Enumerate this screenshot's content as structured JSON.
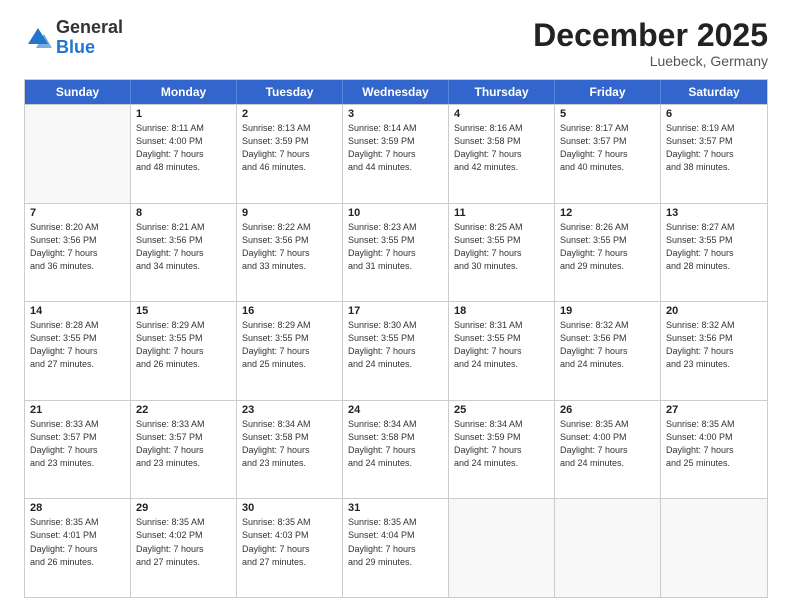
{
  "header": {
    "logo_general": "General",
    "logo_blue": "Blue",
    "month_title": "December 2025",
    "location": "Luebeck, Germany"
  },
  "calendar": {
    "days_of_week": [
      "Sunday",
      "Monday",
      "Tuesday",
      "Wednesday",
      "Thursday",
      "Friday",
      "Saturday"
    ],
    "rows": [
      [
        {
          "day": "",
          "empty": true
        },
        {
          "day": "1",
          "lines": [
            "Sunrise: 8:11 AM",
            "Sunset: 4:00 PM",
            "Daylight: 7 hours",
            "and 48 minutes."
          ]
        },
        {
          "day": "2",
          "lines": [
            "Sunrise: 8:13 AM",
            "Sunset: 3:59 PM",
            "Daylight: 7 hours",
            "and 46 minutes."
          ]
        },
        {
          "day": "3",
          "lines": [
            "Sunrise: 8:14 AM",
            "Sunset: 3:59 PM",
            "Daylight: 7 hours",
            "and 44 minutes."
          ]
        },
        {
          "day": "4",
          "lines": [
            "Sunrise: 8:16 AM",
            "Sunset: 3:58 PM",
            "Daylight: 7 hours",
            "and 42 minutes."
          ]
        },
        {
          "day": "5",
          "lines": [
            "Sunrise: 8:17 AM",
            "Sunset: 3:57 PM",
            "Daylight: 7 hours",
            "and 40 minutes."
          ]
        },
        {
          "day": "6",
          "lines": [
            "Sunrise: 8:19 AM",
            "Sunset: 3:57 PM",
            "Daylight: 7 hours",
            "and 38 minutes."
          ]
        }
      ],
      [
        {
          "day": "7",
          "lines": [
            "Sunrise: 8:20 AM",
            "Sunset: 3:56 PM",
            "Daylight: 7 hours",
            "and 36 minutes."
          ]
        },
        {
          "day": "8",
          "lines": [
            "Sunrise: 8:21 AM",
            "Sunset: 3:56 PM",
            "Daylight: 7 hours",
            "and 34 minutes."
          ]
        },
        {
          "day": "9",
          "lines": [
            "Sunrise: 8:22 AM",
            "Sunset: 3:56 PM",
            "Daylight: 7 hours",
            "and 33 minutes."
          ]
        },
        {
          "day": "10",
          "lines": [
            "Sunrise: 8:23 AM",
            "Sunset: 3:55 PM",
            "Daylight: 7 hours",
            "and 31 minutes."
          ]
        },
        {
          "day": "11",
          "lines": [
            "Sunrise: 8:25 AM",
            "Sunset: 3:55 PM",
            "Daylight: 7 hours",
            "and 30 minutes."
          ]
        },
        {
          "day": "12",
          "lines": [
            "Sunrise: 8:26 AM",
            "Sunset: 3:55 PM",
            "Daylight: 7 hours",
            "and 29 minutes."
          ]
        },
        {
          "day": "13",
          "lines": [
            "Sunrise: 8:27 AM",
            "Sunset: 3:55 PM",
            "Daylight: 7 hours",
            "and 28 minutes."
          ]
        }
      ],
      [
        {
          "day": "14",
          "lines": [
            "Sunrise: 8:28 AM",
            "Sunset: 3:55 PM",
            "Daylight: 7 hours",
            "and 27 minutes."
          ]
        },
        {
          "day": "15",
          "lines": [
            "Sunrise: 8:29 AM",
            "Sunset: 3:55 PM",
            "Daylight: 7 hours",
            "and 26 minutes."
          ]
        },
        {
          "day": "16",
          "lines": [
            "Sunrise: 8:29 AM",
            "Sunset: 3:55 PM",
            "Daylight: 7 hours",
            "and 25 minutes."
          ]
        },
        {
          "day": "17",
          "lines": [
            "Sunrise: 8:30 AM",
            "Sunset: 3:55 PM",
            "Daylight: 7 hours",
            "and 24 minutes."
          ]
        },
        {
          "day": "18",
          "lines": [
            "Sunrise: 8:31 AM",
            "Sunset: 3:55 PM",
            "Daylight: 7 hours",
            "and 24 minutes."
          ]
        },
        {
          "day": "19",
          "lines": [
            "Sunrise: 8:32 AM",
            "Sunset: 3:56 PM",
            "Daylight: 7 hours",
            "and 24 minutes."
          ]
        },
        {
          "day": "20",
          "lines": [
            "Sunrise: 8:32 AM",
            "Sunset: 3:56 PM",
            "Daylight: 7 hours",
            "and 23 minutes."
          ]
        }
      ],
      [
        {
          "day": "21",
          "lines": [
            "Sunrise: 8:33 AM",
            "Sunset: 3:57 PM",
            "Daylight: 7 hours",
            "and 23 minutes."
          ]
        },
        {
          "day": "22",
          "lines": [
            "Sunrise: 8:33 AM",
            "Sunset: 3:57 PM",
            "Daylight: 7 hours",
            "and 23 minutes."
          ]
        },
        {
          "day": "23",
          "lines": [
            "Sunrise: 8:34 AM",
            "Sunset: 3:58 PM",
            "Daylight: 7 hours",
            "and 23 minutes."
          ]
        },
        {
          "day": "24",
          "lines": [
            "Sunrise: 8:34 AM",
            "Sunset: 3:58 PM",
            "Daylight: 7 hours",
            "and 24 minutes."
          ]
        },
        {
          "day": "25",
          "lines": [
            "Sunrise: 8:34 AM",
            "Sunset: 3:59 PM",
            "Daylight: 7 hours",
            "and 24 minutes."
          ]
        },
        {
          "day": "26",
          "lines": [
            "Sunrise: 8:35 AM",
            "Sunset: 4:00 PM",
            "Daylight: 7 hours",
            "and 24 minutes."
          ]
        },
        {
          "day": "27",
          "lines": [
            "Sunrise: 8:35 AM",
            "Sunset: 4:00 PM",
            "Daylight: 7 hours",
            "and 25 minutes."
          ]
        }
      ],
      [
        {
          "day": "28",
          "lines": [
            "Sunrise: 8:35 AM",
            "Sunset: 4:01 PM",
            "Daylight: 7 hours",
            "and 26 minutes."
          ]
        },
        {
          "day": "29",
          "lines": [
            "Sunrise: 8:35 AM",
            "Sunset: 4:02 PM",
            "Daylight: 7 hours",
            "and 27 minutes."
          ]
        },
        {
          "day": "30",
          "lines": [
            "Sunrise: 8:35 AM",
            "Sunset: 4:03 PM",
            "Daylight: 7 hours",
            "and 27 minutes."
          ]
        },
        {
          "day": "31",
          "lines": [
            "Sunrise: 8:35 AM",
            "Sunset: 4:04 PM",
            "Daylight: 7 hours",
            "and 29 minutes."
          ]
        },
        {
          "day": "",
          "empty": true
        },
        {
          "day": "",
          "empty": true
        },
        {
          "day": "",
          "empty": true
        }
      ]
    ]
  }
}
